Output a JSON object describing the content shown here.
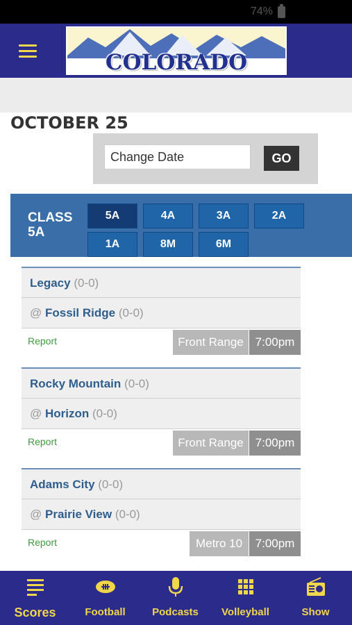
{
  "status_bar": {
    "battery": "74%"
  },
  "header": {
    "logo_text": "COLORADO PREPS"
  },
  "date": {
    "title": "OCTOBER 25",
    "input_placeholder": "Change Date",
    "go_label": "GO"
  },
  "class_selector": {
    "label": "CLASS 5A",
    "options": [
      "5A",
      "4A",
      "3A",
      "2A",
      "1A",
      "8M",
      "6M"
    ],
    "selected": "5A"
  },
  "games": [
    {
      "home": "Legacy",
      "home_record": "(0-0)",
      "at": "@",
      "away": "Fossil Ridge",
      "away_record": "(0-0)",
      "report": "Report",
      "league": "Front Range",
      "time": "7:00pm"
    },
    {
      "home": "Rocky Mountain",
      "home_record": "(0-0)",
      "at": "@",
      "away": "Horizon",
      "away_record": "(0-0)",
      "report": "Report",
      "league": "Front Range",
      "time": "7:00pm"
    },
    {
      "home": "Adams City",
      "home_record": "(0-0)",
      "at": "@",
      "away": "Prairie View",
      "away_record": "(0-0)",
      "report": "Report",
      "league": "Metro 10",
      "time": "7:00pm"
    }
  ],
  "bottom_nav": {
    "items": [
      {
        "label": "Scores",
        "icon": "scores-icon"
      },
      {
        "label": "Football",
        "icon": "football-icon"
      },
      {
        "label": "Podcasts",
        "icon": "microphone-icon"
      },
      {
        "label": "Volleyball",
        "icon": "grid-icon"
      },
      {
        "label": "Show",
        "icon": "radio-icon"
      }
    ],
    "active": "Scores"
  },
  "colors": {
    "primary": "#2b2b8c",
    "accent": "#f0d64a",
    "class_bar": "#3a6ea9",
    "report": "#3f9a3f"
  }
}
